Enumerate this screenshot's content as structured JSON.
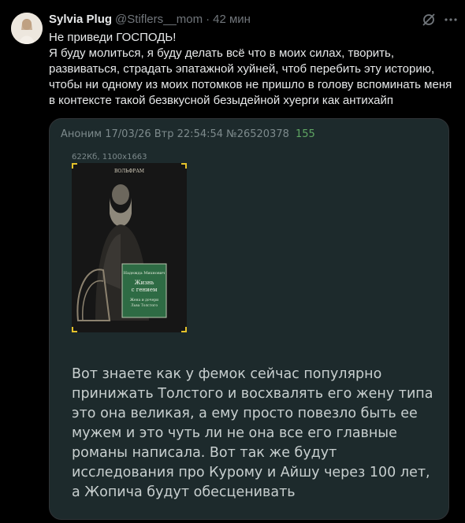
{
  "tweet": {
    "display_name": "Sylvia Plug",
    "handle": "@Stiflers__mom",
    "separator": "·",
    "time": "42 мин",
    "lines": [
      "Не приведи ГОСПОДЬ!",
      "Я буду молиться, я буду делать всё что в моих силах, творить, развиваться, страдать эпатажной хуйней, чтоб перебить эту историю, чтобы ни одному из моих потомков не пришло в голову вспоминать меня в контексте такой безвкусной безыдейной хуерги как антихайп"
    ]
  },
  "post": {
    "author": "Аноним",
    "date": "17/03/26 Втр 22:54:54",
    "number": "№26520378",
    "replies": "155",
    "file_info": "622Кб, 1100x1663",
    "body": "Вот знаете как у фемок сейчас популярно принижать Толстого и восхвалять его жену типа это она великая, а ему просто повезло быть ее мужем и это чуть ли не она все его главные романы написала. Вот так же будут исследования про Курому и Айшу через 100 лет, а Жопича будут обесценивать"
  },
  "book_cover": {
    "publisher": "ВОЛЬФРАМ",
    "author": "Надежда Михнович",
    "title_line1": "Жизнь",
    "title_line2": "с гением",
    "subtitle_line1": "Жена и дочери",
    "subtitle_line2": "Льва Толстого"
  },
  "colors": {
    "background": "#000000",
    "card": "#1d2a2c",
    "reply_count": "#5fa663",
    "cover_accent": "#e5c22a"
  },
  "icons": [
    "avatar",
    "grok-icon",
    "more-icon"
  ]
}
